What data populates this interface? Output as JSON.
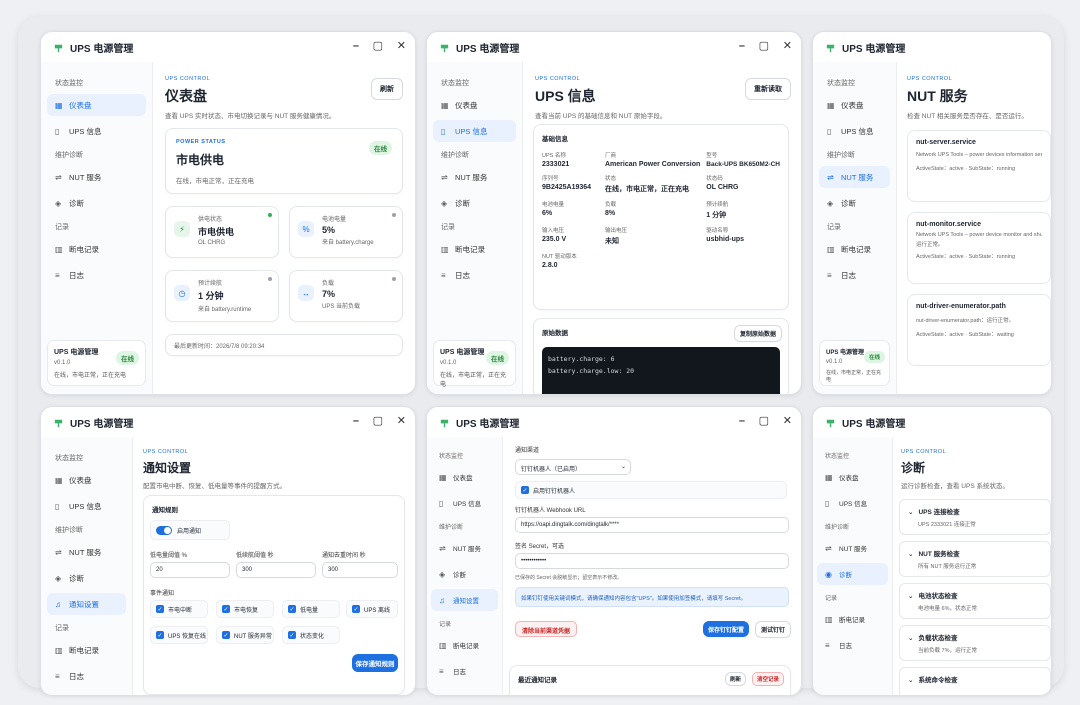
{
  "app": {
    "title": "UPS 电源管理",
    "kicker": "UPS CONTROL",
    "version": "v0.1.0",
    "status_badge": "在线",
    "status_text": "在线，市电正常，正在充电"
  },
  "nav": {
    "sections": [
      "状态监控",
      "维护诊断",
      "记录"
    ],
    "dashboard": "仪表盘",
    "ups_info": "UPS 信息",
    "nut": "NUT 服务",
    "diag": "诊断",
    "notify": "通知设置",
    "power_log": "断电记录",
    "log": "日志"
  },
  "dashboard": {
    "title": "仪表盘",
    "subtitle": "查看 UPS 实时状态、市电切换记录与 NUT 服务健康情况。",
    "refresh": "刷新",
    "power_status_label": "POWER STATUS",
    "power_status": "市电供电",
    "power_status_badge": "在线",
    "power_status_desc": "在线，市电正常，正在充电",
    "metrics": [
      {
        "label": "供电状态",
        "value": "市电供电",
        "sub": "OL CHRG"
      },
      {
        "label": "电池电量",
        "value": "5%",
        "sub": "来自 battery.charge"
      },
      {
        "label": "预计续航",
        "value": "1 分钟",
        "sub": "来自 battery.runtime"
      },
      {
        "label": "负载",
        "value": "7%",
        "sub": "UPS 当前负载"
      }
    ],
    "updated": "最后更新时间：2026/7/8 09:20:34"
  },
  "info": {
    "title": "UPS 信息",
    "subtitle": "查看当前 UPS 的基础信息和 NUT 原始字段。",
    "reload": "重新读取",
    "basic_title": "基础信息",
    "fields": [
      {
        "k": "UPS 名称",
        "v": "2333021"
      },
      {
        "k": "厂商",
        "v": "American Power Conversion"
      },
      {
        "k": "型号",
        "v": "Back-UPS BK650M2-CH"
      },
      {
        "k": "序列号",
        "v": "9B2425A19364"
      },
      {
        "k": "状态",
        "v": "在线，市电正常，正在充电"
      },
      {
        "k": "状态码",
        "v": "OL CHRG"
      },
      {
        "k": "电池电量",
        "v": "6%"
      },
      {
        "k": "负载",
        "v": "8%"
      },
      {
        "k": "预计续航",
        "v": "1 分钟"
      },
      {
        "k": "输入电压",
        "v": "235.0 V"
      },
      {
        "k": "输出电压",
        "v": "未知"
      },
      {
        "k": "驱动名称",
        "v": "usbhid-ups"
      },
      {
        "k": "NUT 驱动版本",
        "v": "2.8.0"
      }
    ],
    "raw_title": "原始数据",
    "copy_raw": "复制原始数据",
    "raw_line1": "battery.charge: 6",
    "raw_line2": "battery.charge.low: 20"
  },
  "nut": {
    "title": "NUT 服务",
    "subtitle": "检查 NUT 相关服务是否存在、是否运行。",
    "services": [
      {
        "name": "nut-server.service",
        "desc": "Network UPS Tools – power devices information server",
        "state": "ActiveState：active · SubState：running"
      },
      {
        "name": "nut-monitor.service",
        "desc": "Network UPS Tools – power device monitor and shutdown controller",
        "extra": "运行正常。",
        "state": "ActiveState：active · SubState：running"
      },
      {
        "name": "nut-driver-enumerator.path",
        "desc": "nut-driver-enumerator.path：运行正常。",
        "state": "ActiveState：active · SubState：waiting"
      }
    ]
  },
  "notify": {
    "title": "通知设置",
    "subtitle": "配置市电中断、恢复、低电量等事件的提醒方式。",
    "rules_title": "通知规则",
    "enable": "启用通知",
    "low_batt_label": "低电量阈值 %",
    "low_batt": "20",
    "low_runtime_label": "低续航阈值 秒",
    "low_runtime": "300",
    "cooldown_label": "通知去重时间 秒",
    "cooldown": "300",
    "events_label": "事件通知",
    "events": [
      "市电中断",
      "市电恢复",
      "低电量",
      "UPS 离线",
      "UPS 恢复在线",
      "NUT 服务异常",
      "状态变化"
    ],
    "save_rules": "保存通知规则"
  },
  "channel": {
    "label": "通知渠道",
    "select": "钉钉机器人（已启用）",
    "enable_bot": "启用钉钉机器人",
    "webhook_label": "钉钉机器人 Webhook URL",
    "webhook": "https://oapi.dingtalk.com/dingtalk/****",
    "secret_label": "签名 Secret，可选",
    "secret": "••••••••••••",
    "secret_hint": "已保存的 Secret 会脱敏显示；留空表示不修改。",
    "tip": "如果钉钉使用关键词模式，请确保通知内容包含\"UPS\"。如果使用加签模式，请填写 Secret。",
    "clear": "清除当前渠道凭据",
    "save": "保存钉钉配置",
    "test": "测试钉钉",
    "recent": "最近通知记录",
    "refresh": "刷新",
    "clear_log": "清空记录"
  },
  "diagp": {
    "title": "诊断",
    "subtitle": "运行诊断检查，查看 UPS 系统状态。",
    "checks": [
      {
        "t": "UPS 连接检查",
        "d": "UPS 2333021 连接正常"
      },
      {
        "t": "NUT 服务检查",
        "d": "所有 NUT 服务运行正常"
      },
      {
        "t": "电池状态检查",
        "d": "电池电量 6%，状态正常"
      },
      {
        "t": "负载状态检查",
        "d": "当前负载 7%，运行正常"
      },
      {
        "t": "系统命令检查",
        "d": ""
      }
    ]
  }
}
